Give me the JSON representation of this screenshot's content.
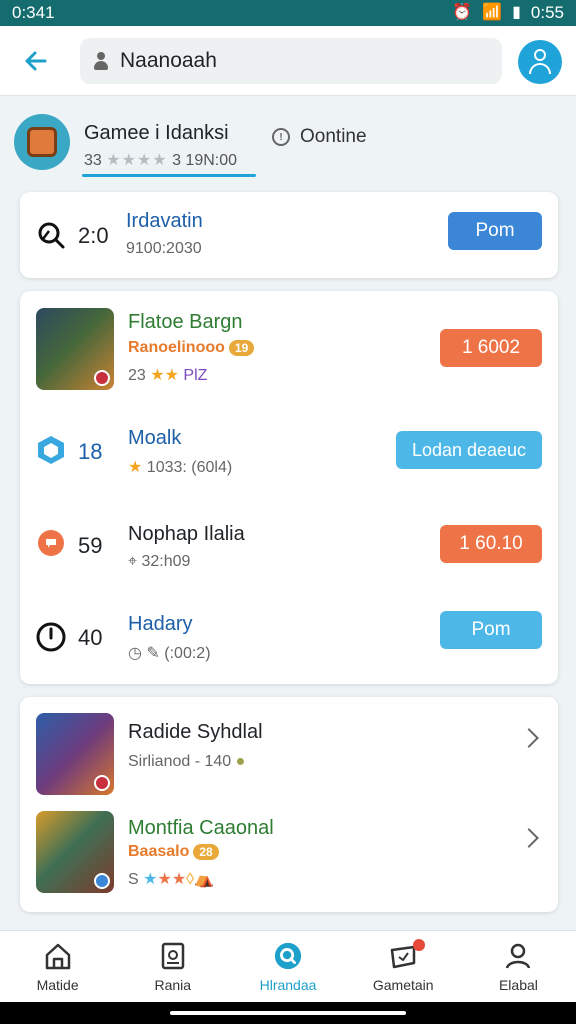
{
  "status_bar": {
    "time_left": "0:341",
    "time_right": "0:55"
  },
  "search": {
    "value": "Naanoaah"
  },
  "profile": {
    "name": "Gamee i Idanksi",
    "rating_prefix": "33",
    "rating_suffix": "3 19N:00",
    "stars_filled": 0,
    "online_label": "Oontine"
  },
  "card1": {
    "rank": "2:0",
    "title": "Irdavatin",
    "subtitle": "9100:2030",
    "button": "Pom"
  },
  "card2_rows": [
    {
      "title": "Flatoe Bargn",
      "tag": "Ranoelinooo",
      "pill": "19",
      "sub": "23",
      "sub2": "PlZ",
      "button": "1 6002"
    },
    {
      "rank": "18",
      "title": "Moalk",
      "sub": "1033: (60l4)",
      "button": "Lodan deaeuc"
    },
    {
      "rank": "59",
      "title": "Nophap Ilalia",
      "sub": "32:h09",
      "button": "1 60.10"
    },
    {
      "rank": "40",
      "title": "Hadary",
      "sub": "(:00:2)",
      "button": "Pom"
    }
  ],
  "card3_rows": [
    {
      "title": "Radide Syhdlal",
      "sub": "Sirlianod - 140"
    },
    {
      "title": "Montfia Caaonal",
      "tag": "Baasalo",
      "pill": "28",
      "sub": "S"
    }
  ],
  "nav": [
    {
      "label": "Matide",
      "icon": "home-icon"
    },
    {
      "label": "Rania",
      "icon": "tablet-icon"
    },
    {
      "label": "Hlrandaa",
      "icon": "search-icon"
    },
    {
      "label": "Gametain",
      "icon": "gamepad-icon"
    },
    {
      "label": "Elabal",
      "icon": "profile-icon"
    }
  ],
  "colors": {
    "accent": "#1da0c9",
    "orange": "#ee7347",
    "blue": "#3b86d6",
    "sky": "#4db8e8"
  }
}
